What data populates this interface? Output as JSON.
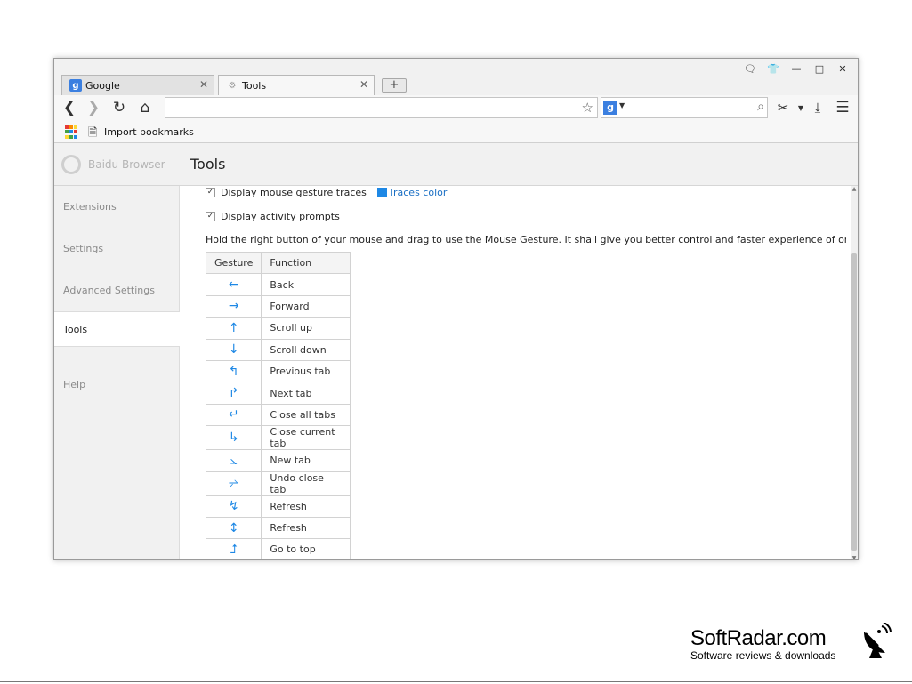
{
  "browser": {
    "tabs": [
      {
        "title": "Google",
        "icon": "google-g-icon"
      },
      {
        "title": "Tools",
        "icon": "gear-icon"
      }
    ],
    "new_tab_label": "+",
    "address": "",
    "search_value": "",
    "search_engine_glyph": "g"
  },
  "bookmarks": {
    "items": [
      {
        "label": "Import bookmarks"
      }
    ]
  },
  "header": {
    "brand": "Baidu Browser",
    "title": "Tools"
  },
  "sidebar": {
    "items": [
      {
        "label": "Extensions"
      },
      {
        "label": "Settings"
      },
      {
        "label": "Advanced Settings"
      },
      {
        "label": "Tools",
        "active": true
      },
      {
        "label": "Help"
      }
    ]
  },
  "gestures": {
    "option_traces": "Display mouse gesture traces",
    "traces_color_label": "Traces color",
    "option_prompts": "Display activity prompts",
    "description": "Hold the right button of your mouse and drag to use the Mouse Gesture. It shall give you better control and faster experience of online surfing.",
    "col_gesture": "Gesture",
    "col_function": "Function",
    "rows": [
      {
        "glyph": "←",
        "function": "Back"
      },
      {
        "glyph": "→",
        "function": "Forward"
      },
      {
        "glyph": "↑",
        "function": "Scroll up"
      },
      {
        "glyph": "↓",
        "function": "Scroll down"
      },
      {
        "glyph": "↰",
        "function": "Previous tab"
      },
      {
        "glyph": "↱",
        "function": "Next tab"
      },
      {
        "glyph": "↵",
        "function": "Close all tabs"
      },
      {
        "glyph": "↳",
        "function": "Close current tab"
      },
      {
        "glyph": "⦣",
        "function": "New tab"
      },
      {
        "glyph": "⥨",
        "function": "Undo close tab"
      },
      {
        "glyph": "↯",
        "function": "Refresh"
      },
      {
        "glyph": "↕",
        "function": "Refresh"
      },
      {
        "glyph": "⮥",
        "function": "Go to top"
      },
      {
        "glyph": "↧",
        "function": ""
      }
    ]
  },
  "watermark": {
    "title": "SoftRadar.com",
    "subtitle": "Software reviews & downloads"
  },
  "colors": {
    "accent": "#1e88e5",
    "link": "#1a6fc4"
  }
}
